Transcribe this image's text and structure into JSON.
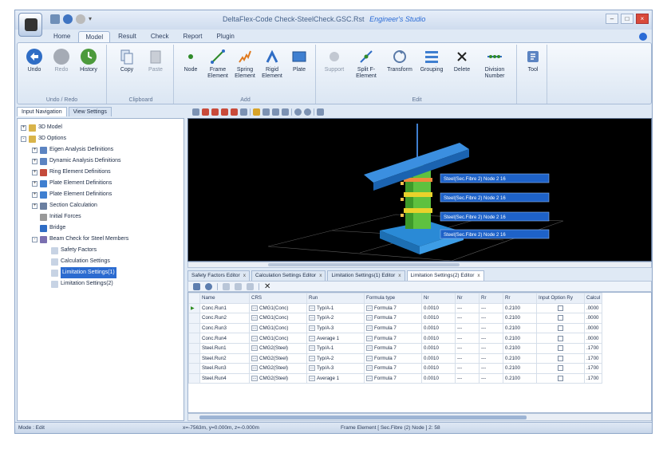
{
  "window": {
    "title": "DeltaFlex-Code Check-SteelCheck.GSC.Rst",
    "brand": "Engineer's Studio"
  },
  "tabs": [
    "Home",
    "Model",
    "Result",
    "Check",
    "Report",
    "Plugin"
  ],
  "active_tab": "Model",
  "ribbon": {
    "groups": [
      {
        "label": "Undo / Redo",
        "buttons": [
          "Undo",
          "Redo",
          "History"
        ]
      },
      {
        "label": "Clipboard",
        "buttons": [
          "Copy",
          "Paste"
        ]
      },
      {
        "label": "Add",
        "buttons": [
          "Node",
          "Frame Element",
          "Spring Element",
          "Rigid Element",
          "Plate"
        ]
      },
      {
        "label": "Edit",
        "buttons": [
          "Support",
          "Split F-Element",
          "Transform",
          "Grouping",
          "Delete",
          "Division Number"
        ]
      },
      {
        "label": "",
        "buttons": [
          "Tool"
        ]
      }
    ]
  },
  "left_tabs": [
    "Input Navigation",
    "View Settings"
  ],
  "tree": [
    {
      "label": "3D Model",
      "level": 0,
      "exp": "+",
      "icon": "folder-icon"
    },
    {
      "label": "3D Options",
      "level": 0,
      "exp": "-",
      "icon": "folder-icon"
    },
    {
      "label": "Eigen Analysis Definitions",
      "level": 1,
      "exp": "+",
      "icon": "list-icon"
    },
    {
      "label": "Dynamic Analysis Definitions",
      "level": 1,
      "exp": "+",
      "icon": "list-icon"
    },
    {
      "label": "Ring Element Definitions",
      "level": 1,
      "exp": "+",
      "icon": "ring-icon"
    },
    {
      "label": "Plate Element Definitions",
      "level": 1,
      "exp": "+",
      "icon": "plate-icon"
    },
    {
      "label": "Plate Element Definitions",
      "level": 1,
      "exp": "+",
      "icon": "plate-icon"
    },
    {
      "label": "Section Calculation",
      "level": 1,
      "exp": "+",
      "icon": "calc-icon"
    },
    {
      "label": "Initial Forces",
      "level": 1,
      "exp": "",
      "icon": "force-icon"
    },
    {
      "label": "Bridge",
      "level": 1,
      "exp": "",
      "icon": "bridge-icon"
    },
    {
      "label": "Beam Check for Steel Members",
      "level": 1,
      "exp": "-",
      "icon": "check-icon"
    },
    {
      "label": "Safety Factors",
      "level": 2,
      "exp": "",
      "icon": "doc-icon"
    },
    {
      "label": "Calculation Settings",
      "level": 2,
      "exp": "",
      "icon": "doc-icon"
    },
    {
      "label": "Limitation Settings(1)",
      "level": 2,
      "exp": "",
      "icon": "doc-icon",
      "selected": true
    },
    {
      "label": "Limitation Settings(2)",
      "level": 2,
      "exp": "",
      "icon": "doc-icon"
    }
  ],
  "viewport": {
    "labels": [
      "Steel(Sec.Fibre 2) Node 2 16",
      "Steel(Sec.Fibre 2) Node 2 16",
      "Steel(Sec.Fibre 2) Node 2 16",
      "Steel(Sec.Fibre 2) Node 2 16"
    ]
  },
  "editor_tabs": [
    "Safety Factors Editor",
    "Calculation Settings Editor",
    "Limitation Settings(1) Editor",
    "Limitation Settings(2) Editor"
  ],
  "active_editor_tab": 3,
  "grid": {
    "headers": [
      "Name",
      "CRS",
      "Run",
      "Formula type",
      "Nr",
      "Nr",
      "Rr",
      "Rr",
      "Input Option Ry",
      "Calcul"
    ],
    "rows": [
      [
        "Conc.Run1",
        "CMG1(Conc)",
        "Typ/A-1",
        "Formula 7",
        "0.0010",
        "---",
        "---",
        "0.2100",
        ".0000"
      ],
      [
        "Conc.Run2",
        "CMG1(Conc)",
        "Typ/A-2",
        "Formula 7",
        "0.0010",
        "---",
        "---",
        "0.2100",
        ".0000"
      ],
      [
        "Conc.Run3",
        "CMG1(Conc)",
        "Typ/A-3",
        "Formula 7",
        "0.0010",
        "---",
        "---",
        "0.2100",
        ".0000"
      ],
      [
        "Conc.Run4",
        "CMG1(Conc)",
        "Average 1",
        "Formula 7",
        "0.0010",
        "---",
        "---",
        "0.2100",
        ".0000"
      ],
      [
        "Steel.Run1",
        "CMG2(Steel)",
        "Typ/A-1",
        "Formula 7",
        "0.0010",
        "---",
        "---",
        "0.2100",
        ".1700"
      ],
      [
        "Steel.Run2",
        "CMG2(Steel)",
        "Typ/A-2",
        "Formula 7",
        "0.0010",
        "---",
        "---",
        "0.2100",
        ".1700"
      ],
      [
        "Steel.Run3",
        "CMG2(Steel)",
        "Typ/A-3",
        "Formula 7",
        "0.0010",
        "---",
        "---",
        "0.2100",
        ".1700"
      ],
      [
        "Steel.Run4",
        "CMG2(Steel)",
        "Average 1",
        "Formula 7",
        "0.0010",
        "---",
        "---",
        "0.2100",
        ".1700"
      ]
    ]
  },
  "status": {
    "mode": "Mode : Edit",
    "coords": "x=-7563m, y=0.000m, z=-0.000m",
    "element": "Frame Element [ Sec.Fibre (2) Node ] 2: 58"
  }
}
